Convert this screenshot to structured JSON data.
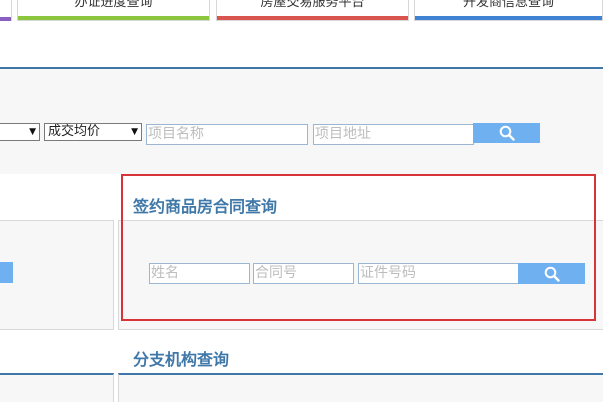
{
  "tabs": [
    {
      "label": "办证进度查询",
      "accent": "#8cc63f"
    },
    {
      "label": "房屋交易服务平台",
      "accent": "#d9534f"
    },
    {
      "label": "开发商信息查询",
      "accent": "#3f83d4"
    }
  ],
  "price_search": {
    "selects": [
      {
        "value": ""
      },
      {
        "value": "成交均价"
      }
    ],
    "project_name_placeholder": "项目名称",
    "project_address_placeholder": "项目地址",
    "search_icon": "magnifier-icon"
  },
  "contract_query": {
    "title": "签约商品房合同查询",
    "name_placeholder": "姓名",
    "contract_no_placeholder": "合同号",
    "id_no_placeholder": "证件号码",
    "search_icon": "magnifier-icon"
  },
  "branch_query": {
    "title": "分支机构查询"
  },
  "colors": {
    "accent_blue": "#3f78a8",
    "button_blue": "#6fb1f0",
    "highlight_red": "#d9333a"
  }
}
